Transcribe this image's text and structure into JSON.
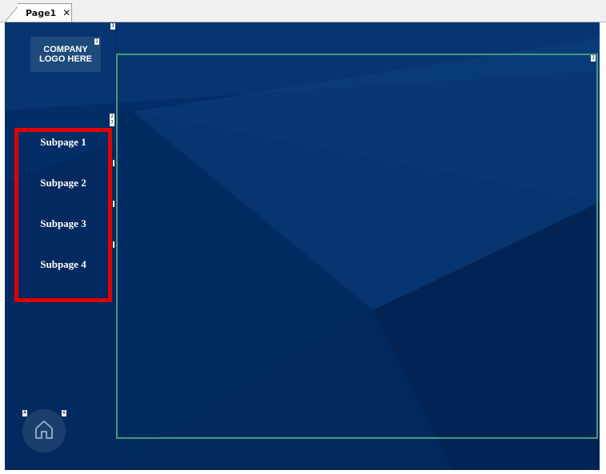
{
  "tabs": [
    {
      "label": "Page1",
      "close_glyph": "✕"
    }
  ],
  "logo": {
    "line1": "COMPANY",
    "line2": "LOGO HERE"
  },
  "nav": {
    "items": [
      {
        "label": "Subpage 1"
      },
      {
        "label": "Subpage 2"
      },
      {
        "label": "Subpage 3"
      },
      {
        "label": "Subpage 4"
      }
    ]
  },
  "markers": {
    "top": "3",
    "logo": "2",
    "content": "1",
    "nav_a": "2",
    "nav_b": "7",
    "home_a": "A",
    "home_b": "6"
  },
  "home": {
    "icon": "home-icon"
  },
  "colors": {
    "background": "#032d66",
    "highlight": "#e10000",
    "frame": "#3f9a7e",
    "logo_box": "#1e4a7c"
  }
}
